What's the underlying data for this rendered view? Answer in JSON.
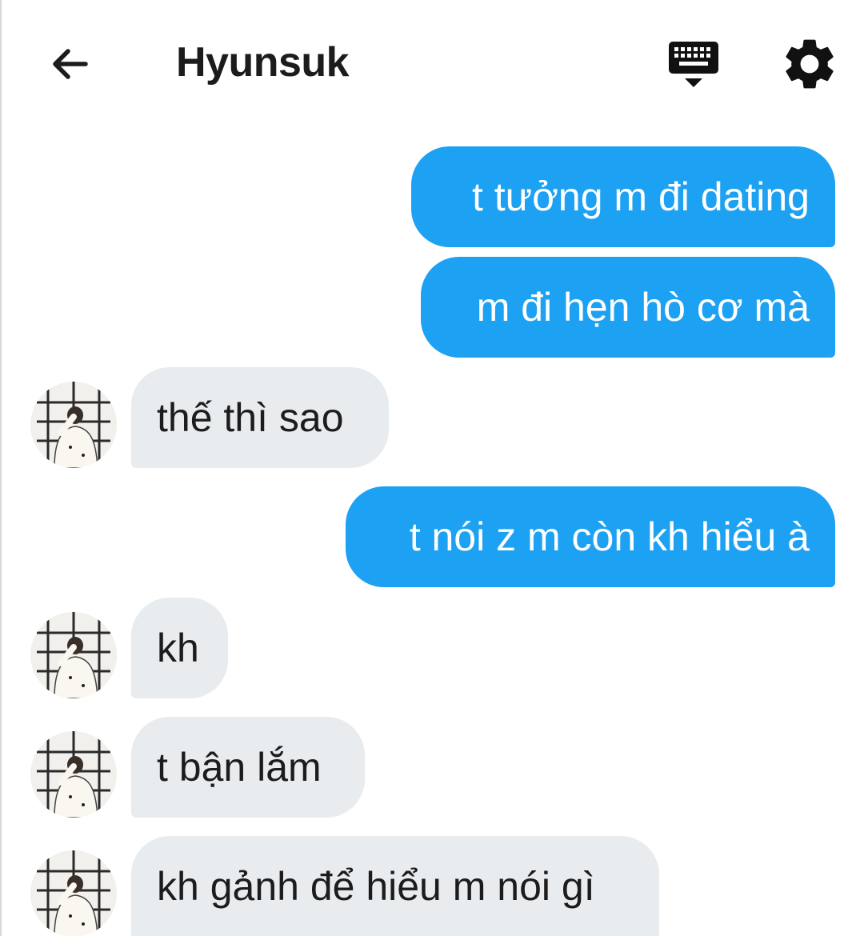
{
  "header": {
    "title": "Hyunsuk",
    "back_icon": "arrow-left-icon",
    "keyboard_icon": "keyboard-icon",
    "settings_icon": "gear-icon"
  },
  "colors": {
    "outgoing_bubble": "#1da1f2",
    "incoming_bubble": "#e8ecef",
    "text_dark": "#1c1c1c"
  },
  "messages": [
    {
      "direction": "out",
      "text": "t tưởng m đi dating"
    },
    {
      "direction": "out",
      "text": "m đi hẹn hò cơ mà"
    },
    {
      "direction": "in",
      "text": "thế thì sao"
    },
    {
      "direction": "out",
      "text": "t nói z m còn kh hiểu à"
    },
    {
      "direction": "in",
      "text": "kh"
    },
    {
      "direction": "in",
      "text": "t bận lắm"
    },
    {
      "direction": "in",
      "text": "kh gảnh để hiểu m nói gì"
    }
  ]
}
